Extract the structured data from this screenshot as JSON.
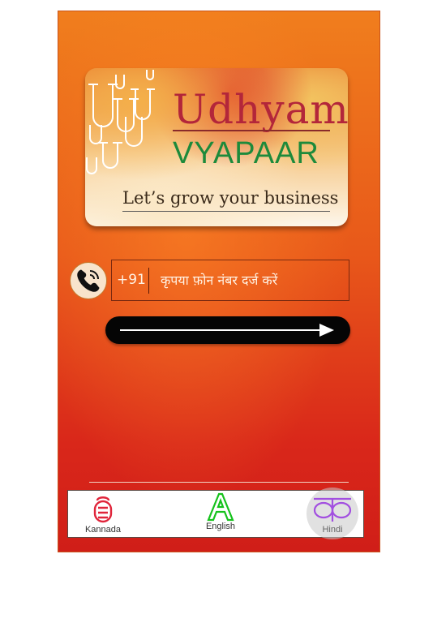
{
  "banner": {
    "title": "Udhyam",
    "subtitle": "VYAPAAR",
    "tagline": "Let’s grow your business"
  },
  "login": {
    "country_code": "+91",
    "phone_placeholder": "कृपया फ़ोन नंबर दर्ज करें"
  },
  "languages": [
    {
      "label": "Kannada",
      "icon": "kannada-script-icon"
    },
    {
      "label": "English",
      "icon": "latin-a-icon"
    },
    {
      "label": "Hindi",
      "icon": "devanagari-ka-icon",
      "selected": true
    }
  ],
  "colors": {
    "title": "#b3263a",
    "subtitle": "#1d8a3b",
    "background_top": "#f07e1d",
    "background_bottom": "#d01e18",
    "kannada_icon": "#e0243a",
    "english_icon": "#15c21c",
    "hindi_icon": "#a24fe0"
  }
}
